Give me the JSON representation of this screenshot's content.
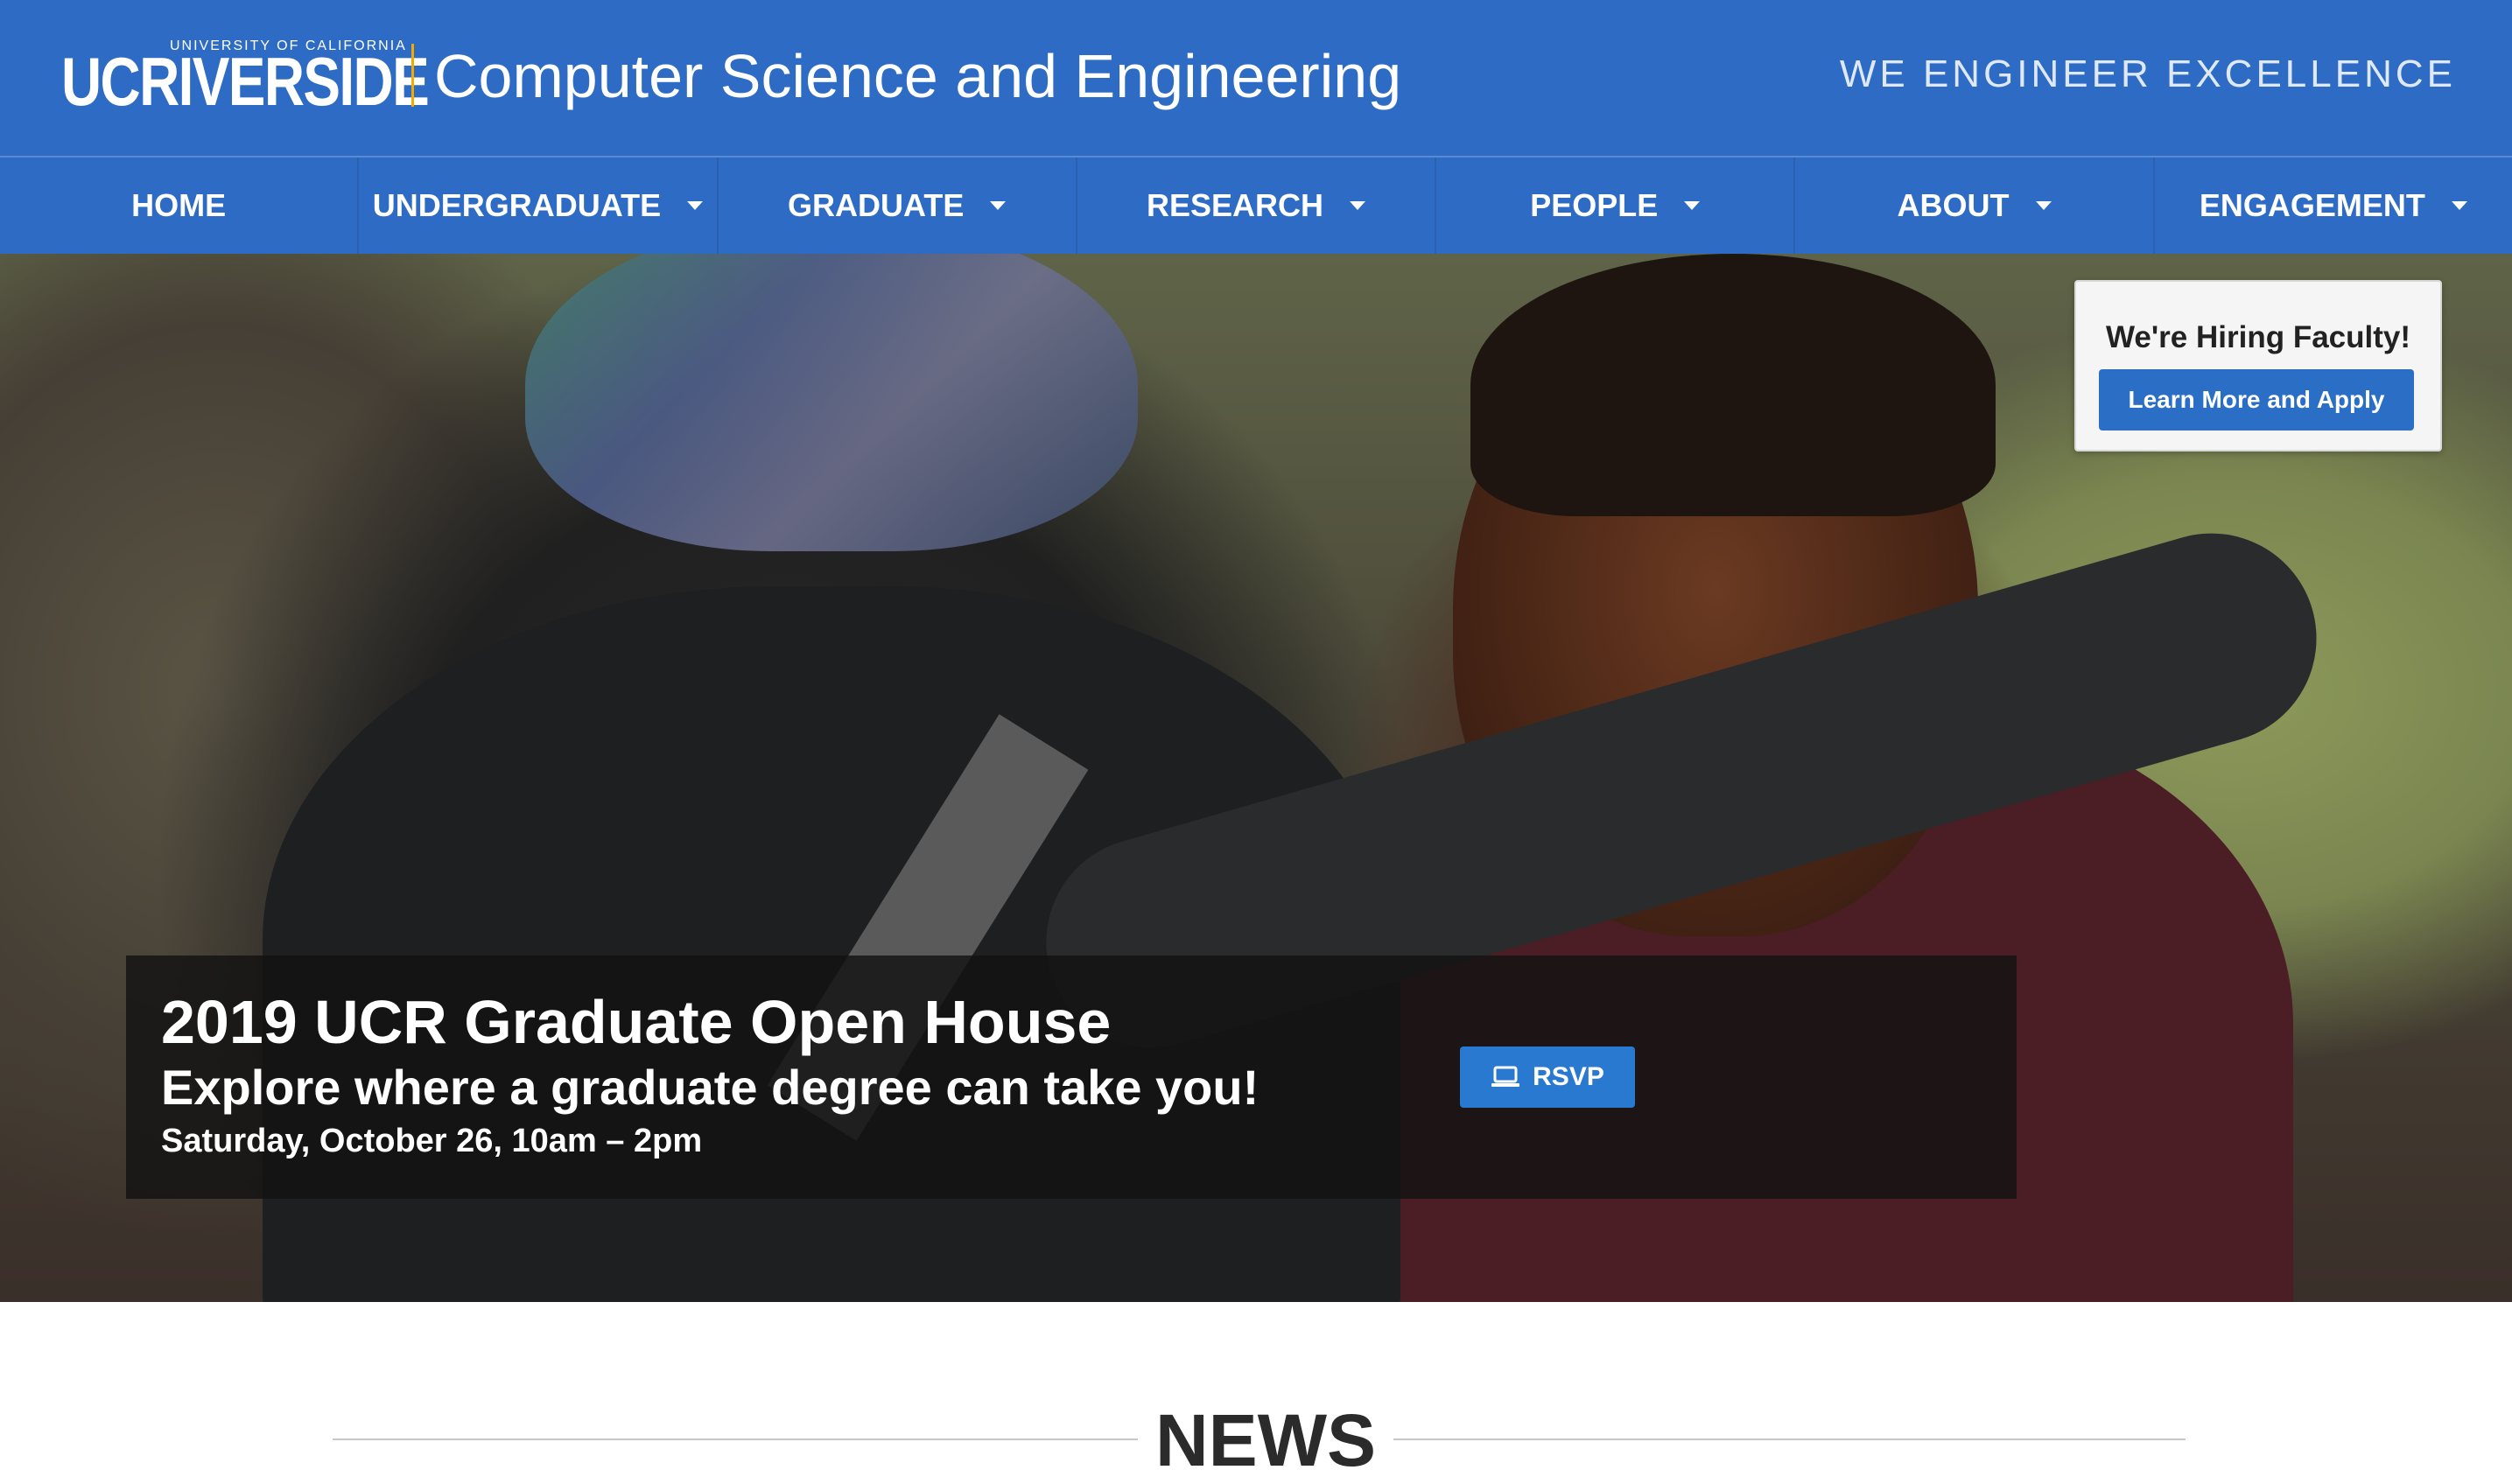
{
  "header": {
    "logo_small": "UNIVERSITY OF CALIFORNIA",
    "logo_main": "UCRIVERSIDE",
    "department": "Computer Science and Engineering",
    "tagline": "WE ENGINEER EXCELLENCE"
  },
  "nav": {
    "items": [
      {
        "label": "HOME",
        "has_dropdown": false
      },
      {
        "label": "UNDERGRADUATE",
        "has_dropdown": true
      },
      {
        "label": "GRADUATE",
        "has_dropdown": true
      },
      {
        "label": "RESEARCH",
        "has_dropdown": true
      },
      {
        "label": "PEOPLE",
        "has_dropdown": true
      },
      {
        "label": "ABOUT",
        "has_dropdown": true
      },
      {
        "label": "ENGAGEMENT",
        "has_dropdown": true
      }
    ]
  },
  "hiring": {
    "title": "We're Hiring Faculty!",
    "button_label": "Learn More and Apply"
  },
  "hero": {
    "title": "2019 UCR Graduate Open House",
    "subtitle": "Explore where a graduate degree can take you!",
    "date": "Saturday, October 26, 10am – 2pm",
    "rsvp_label": "RSVP",
    "rsvp_icon": "laptop-icon"
  },
  "news": {
    "heading": "NEWS"
  },
  "colors": {
    "brand_blue": "#2e6bc5",
    "button_blue": "#2a6fc5",
    "gold": "#f1ab00"
  }
}
